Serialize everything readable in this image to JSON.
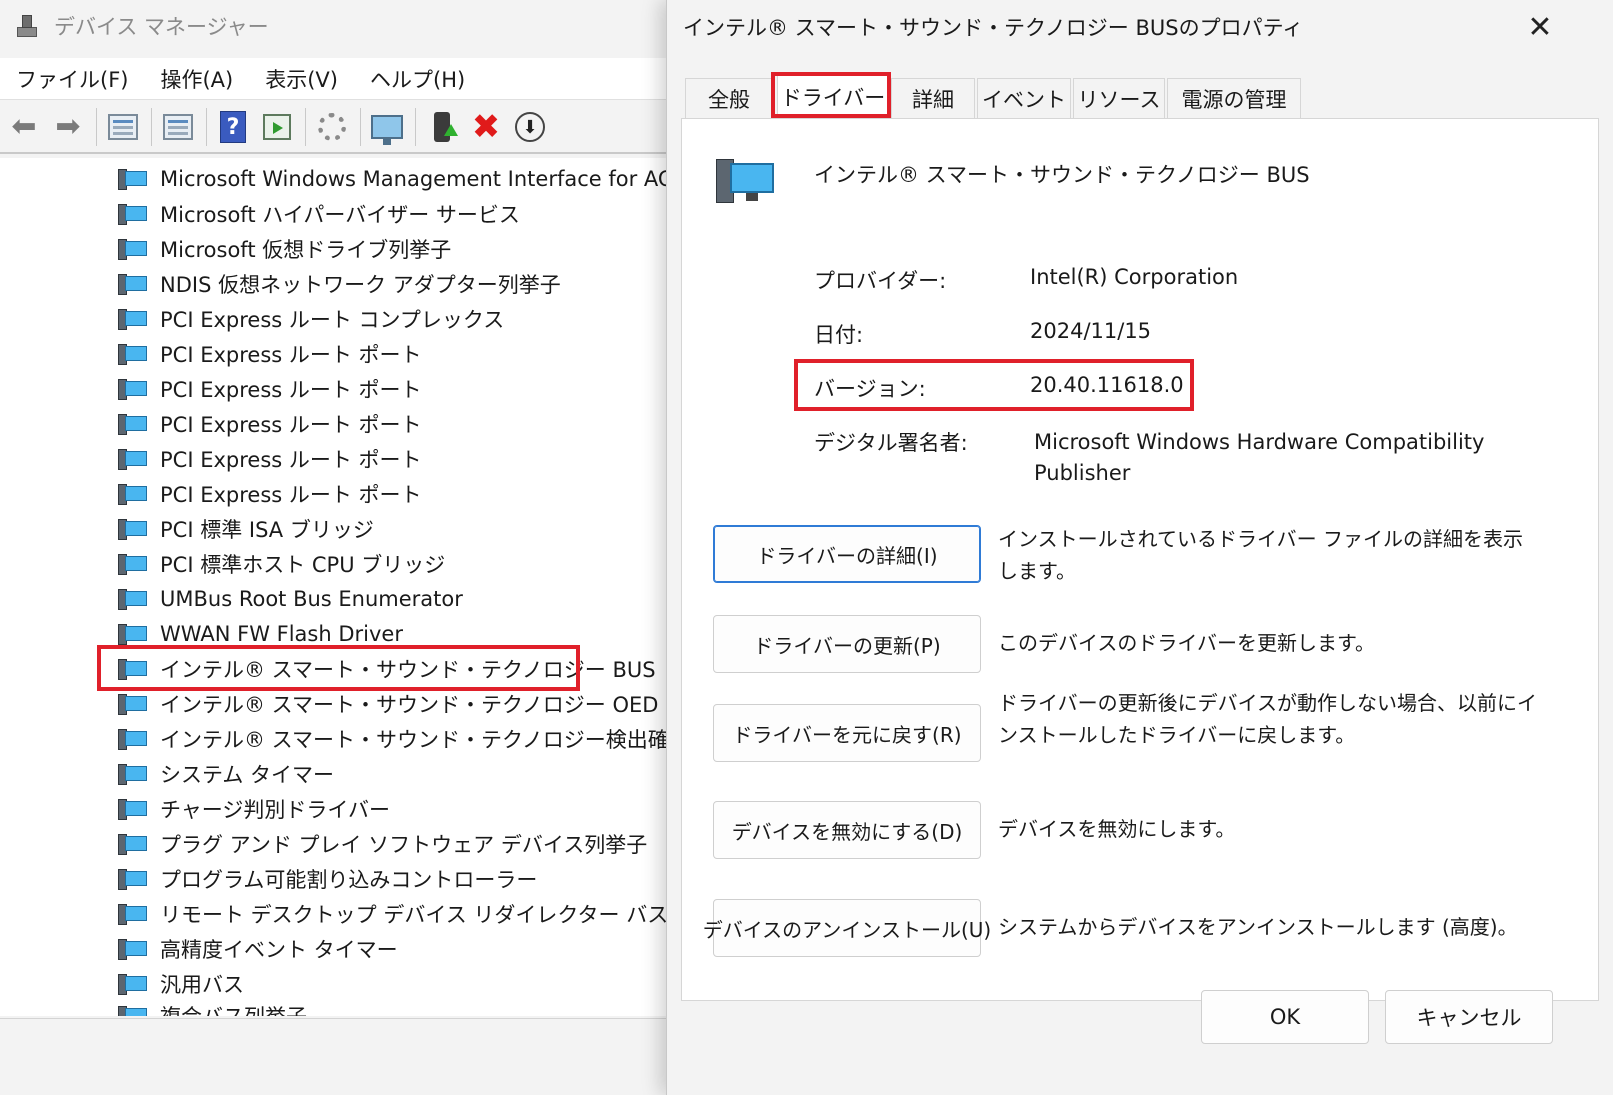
{
  "device_manager": {
    "title": "デバイス マネージャー",
    "menu": [
      "ファイル(F)",
      "操作(A)",
      "表示(V)",
      "ヘルプ(H)"
    ],
    "toolbar_icons": [
      "back-arrow-icon",
      "forward-arrow-icon",
      "console-tree-icon",
      "properties-icon",
      "help-icon",
      "action-pane-icon",
      "update-driver-icon",
      "scan-hardware-icon",
      "add-driver-icon",
      "uninstall-icon",
      "download-icon"
    ],
    "tree_items": [
      "Microsoft Windows Management Interface for ACP",
      "Microsoft ハイパーバイザー サービス",
      "Microsoft 仮想ドライブ列挙子",
      "NDIS 仮想ネットワーク アダプター列挙子",
      "PCI Express ルート コンプレックス",
      "PCI Express ルート ポート",
      "PCI Express ルート ポート",
      "PCI Express ルート ポート",
      "PCI Express ルート ポート",
      "PCI Express ルート ポート",
      "PCI 標準 ISA ブリッジ",
      "PCI 標準ホスト CPU ブリッジ",
      "UMBus Root Bus Enumerator",
      "WWAN FW Flash Driver",
      "インテル® スマート・サウンド・テクノロジー BUS",
      "インテル® スマート・サウンド・テクノロジー OED",
      "インテル® スマート・サウンド・テクノロジー検出確認",
      "システム タイマー",
      "チャージ判別ドライバー",
      "プラグ アンド プレイ ソフトウェア デバイス列挙子",
      "プログラム可能割り込みコントローラー",
      "リモート デスクトップ デバイス リダイレクター バス",
      "高精度イベント タイマー",
      "汎用バス",
      "複合バス列挙子"
    ],
    "selected_item": "インテル® スマート・サウンド・テクノロジー BUS"
  },
  "dialog": {
    "title": "インテル® スマート・サウンド・テクノロジー BUSのプロパティ",
    "tabs": [
      "全般",
      "ドライバー",
      "詳細",
      "イベント",
      "リソース",
      "電源の管理"
    ],
    "active_tab": "ドライバー",
    "device_name": "インテル® スマート・サウンド・テクノロジー BUS",
    "properties": {
      "provider_label": "プロバイダー:",
      "provider_value": "Intel(R) Corporation",
      "date_label": "日付:",
      "date_value": "2024/11/15",
      "version_label": "バージョン:",
      "version_value": "20.40.11618.0",
      "signer_label": "デジタル署名者:",
      "signer_value": "Microsoft Windows Hardware Compatibility Publisher"
    },
    "actions": [
      {
        "label": "ドライバーの詳細(I)",
        "desc": "インストールされているドライバー ファイルの詳細を表示します。"
      },
      {
        "label": "ドライバーの更新(P)",
        "desc": "このデバイスのドライバーを更新します。"
      },
      {
        "label": "ドライバーを元に戻す(R)",
        "desc": "ドライバーの更新後にデバイスが動作しない場合、以前にインストールしたドライバーに戻します。"
      },
      {
        "label": "デバイスを無効にする(D)",
        "desc": "デバイスを無効にします。"
      },
      {
        "label": "デバイスのアンインストール(U)",
        "desc": "システムからデバイスをアンインストールします (高度)。"
      }
    ],
    "ok_label": "OK",
    "cancel_label": "キャンセル"
  },
  "colors": {
    "highlight_box": "#e0202a",
    "focus_blue": "#2f7bd6"
  }
}
